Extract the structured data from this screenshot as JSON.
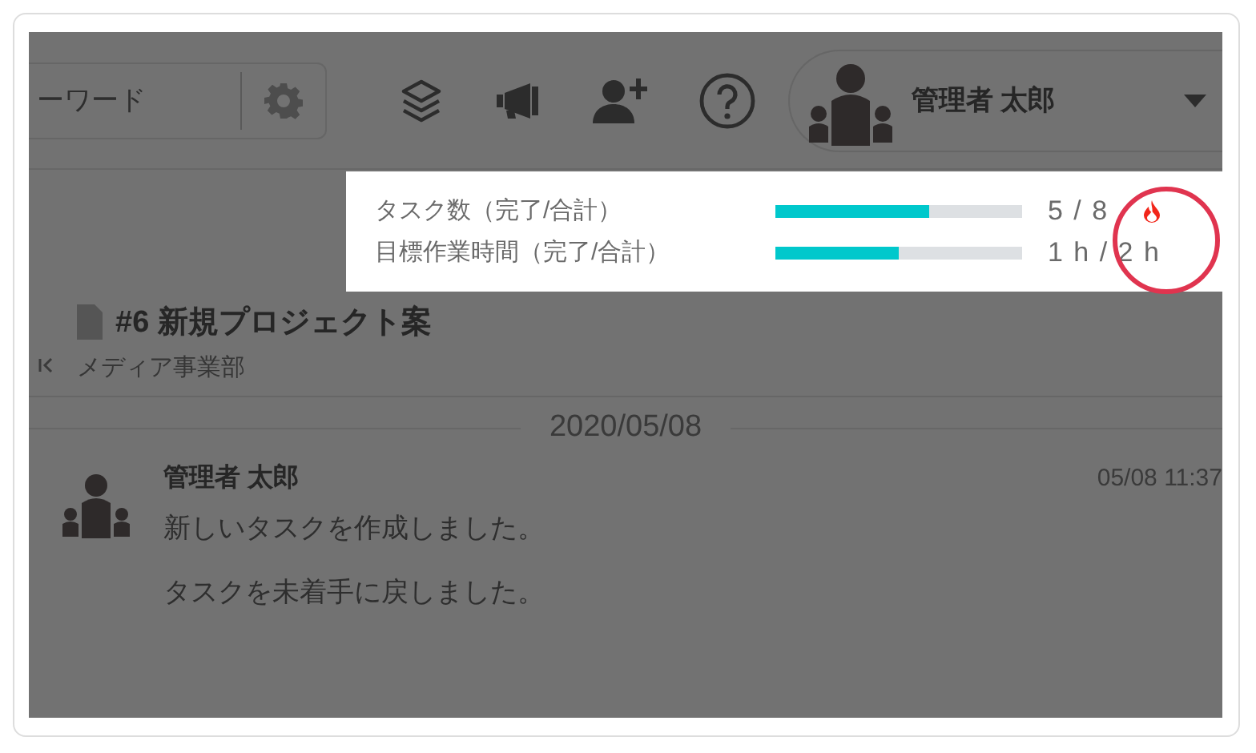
{
  "search": {
    "placeholder": "ーワード"
  },
  "user": {
    "name": "管理者 太郎"
  },
  "progress_popover": {
    "rows": [
      {
        "label": "タスク数（完了/合計）",
        "level": 0.625,
        "value": "5 / 8",
        "flame": true
      },
      {
        "label": "目標作業時間（完了/合計）",
        "level": 0.5,
        "value": "1 h / 2 h",
        "flame": false
      }
    ]
  },
  "task": {
    "title": "#6 新規プロジェクト案",
    "project": "メディア事業部"
  },
  "timeline": {
    "date": "2020/05/08",
    "entries": [
      {
        "author": "管理者 太郎",
        "time": "05/08 11:37",
        "messages": [
          "新しいタスクを作成しました。",
          "タスクを未着手に戻しました。"
        ]
      }
    ]
  }
}
